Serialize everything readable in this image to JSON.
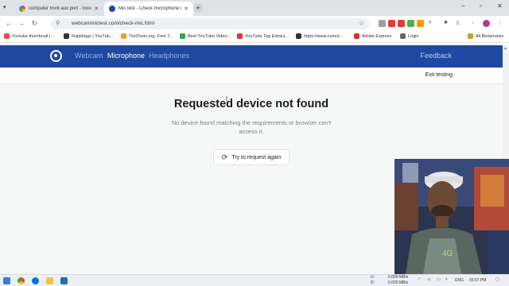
{
  "browser": {
    "tabs": [
      {
        "title": "computer front aux port - Goo...",
        "active": false
      },
      {
        "title": "Mic test - Check microphone o...",
        "active": true
      }
    ],
    "url": "webcammictest.com/check-mic.html",
    "bookmarks": [
      {
        "label": "Youtube thumbnail I...",
        "color": "#ff4444"
      },
      {
        "label": "Rapidtags | YouTub...",
        "color": "#333333"
      },
      {
        "label": "TextTools.org: Free T...",
        "color": "#f0a020"
      },
      {
        "label": "Best YouTube Video...",
        "color": "#2aa84a"
      },
      {
        "label": "YouTube Tag Extract...",
        "color": "#e33"
      },
      {
        "label": "https://www.cutout...",
        "color": "#333"
      },
      {
        "label": "Adobe Express",
        "color": "#e03030"
      },
      {
        "label": "Login",
        "color": "#666"
      }
    ],
    "all_bookmarks": "All Bookmarks"
  },
  "site": {
    "nav": {
      "webcam": "Webcam",
      "microphone": "Microphone",
      "headphones": "Headphones",
      "feedback": "Feedback"
    },
    "exit_testing": "Exit testing",
    "heading": "Requested device not found",
    "description": "No device found matching the requirements or browser can't access it.",
    "retry_label": "Try to request again"
  },
  "taskbar": {
    "upload_label": "U:",
    "download_label": "D:",
    "upload_value": "0.000 MB/s",
    "download_value": "0.000 MB/s",
    "language": "ENG",
    "time": "03:07 PM"
  },
  "colors": {
    "header": "#1f49a0",
    "nav_active": "#ffffff",
    "nav_inactive": "#8fb0ee"
  }
}
